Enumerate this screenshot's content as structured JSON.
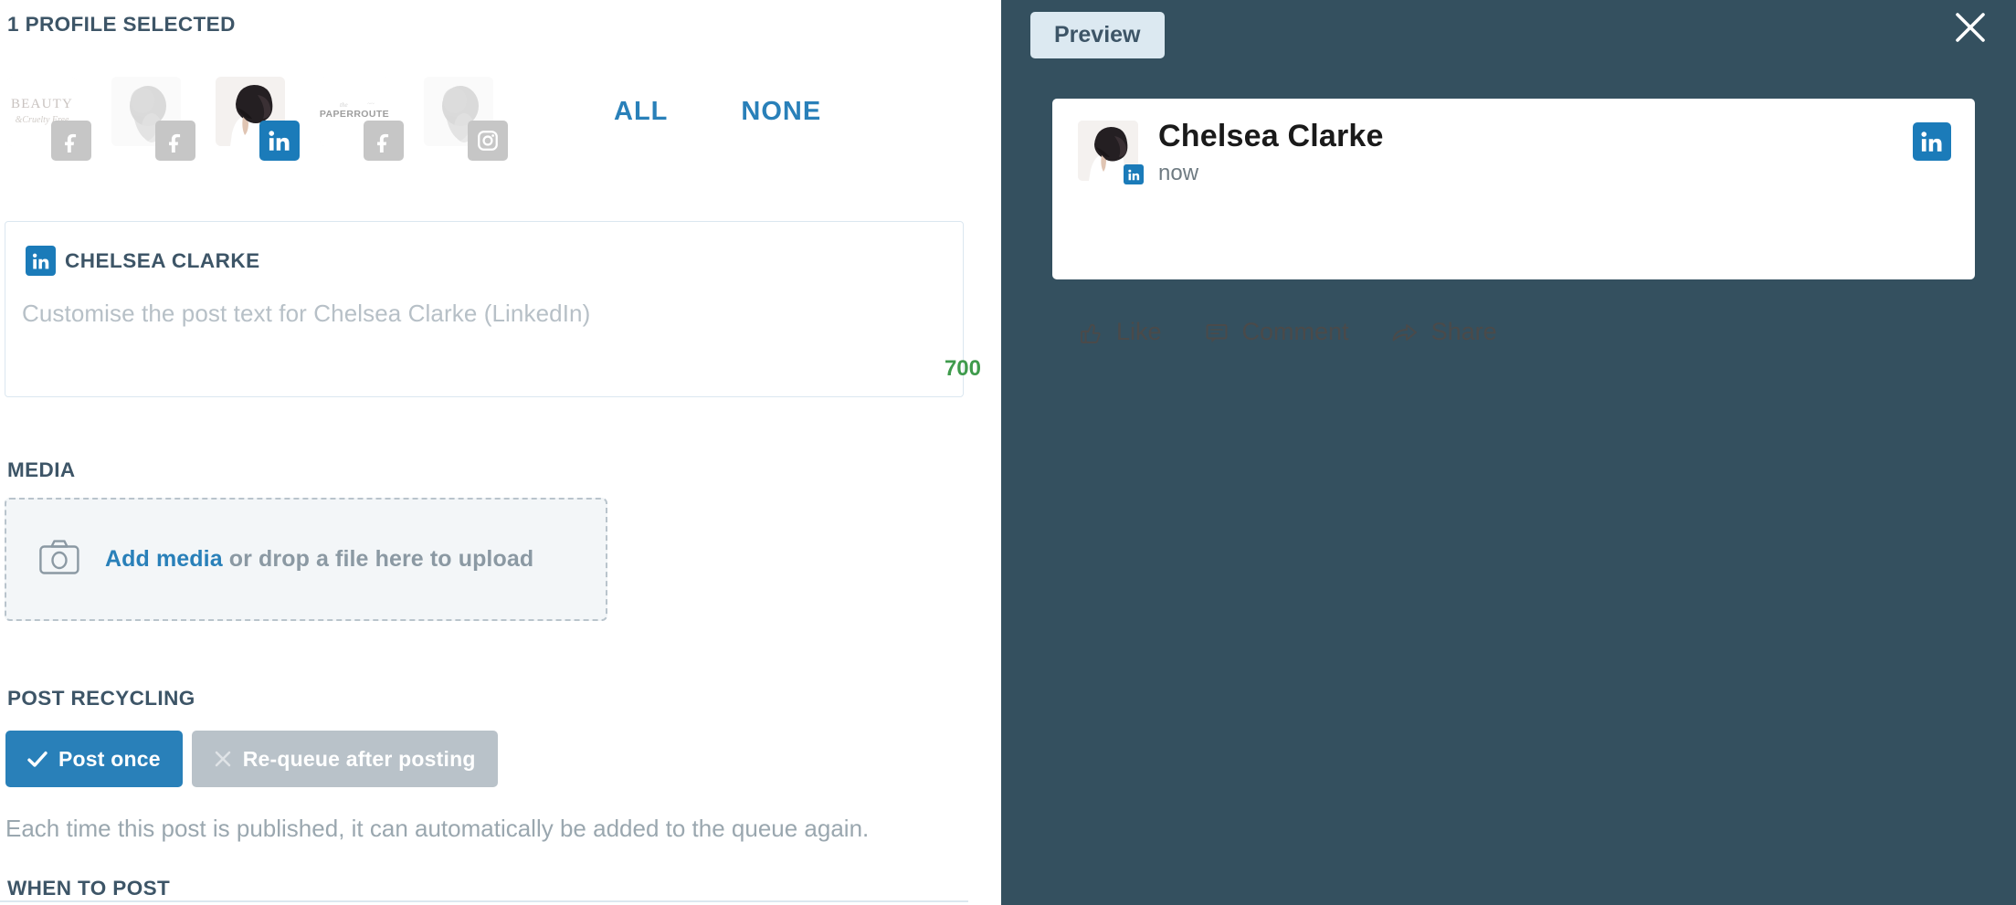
{
  "composer": {
    "profiles_heading": "1 PROFILE SELECTED",
    "profiles": [
      {
        "name": "beauty-cruelty-free",
        "network": "facebook",
        "selected": false,
        "icon": "facebook-icon"
      },
      {
        "name": "hair-profile-2",
        "network": "facebook",
        "selected": false,
        "icon": "facebook-icon"
      },
      {
        "name": "chelsea-clarke",
        "network": "linkedin",
        "selected": true,
        "icon": "linkedin-icon"
      },
      {
        "name": "the-paperroute",
        "network": "facebook",
        "selected": false,
        "icon": "facebook-icon"
      },
      {
        "name": "hair-profile-5",
        "network": "instagram",
        "selected": false,
        "icon": "instagram-icon"
      }
    ],
    "select_all_label": "ALL",
    "select_none_label": "NONE",
    "network_editor": {
      "network_icon": "linkedin-icon",
      "profile_name": "CHELSEA CLARKE",
      "placeholder": "Customise the post text for Chelsea Clarke (LinkedIn)",
      "value": "",
      "char_count": "700",
      "char_count_color": "#3f9b4c"
    },
    "media": {
      "heading": "MEDIA",
      "camera_icon": "camera-icon",
      "link_label": "Add media",
      "rest_label": " or drop a file here to upload"
    },
    "post_recycling": {
      "heading": "POST RECYCLING",
      "options": [
        {
          "label": "Post once",
          "glyph": "check-icon",
          "active": true
        },
        {
          "label": "Re-queue after posting",
          "glyph": "close-icon",
          "active": false
        }
      ],
      "help_text": "Each time this post is published, it can automatically be added to the queue again."
    },
    "when_to_post": {
      "heading": "WHEN TO POST"
    },
    "scrollbar": {
      "name": "composer-scrollbar"
    }
  },
  "preview": {
    "tab_label": "Preview",
    "close_icon": "close-icon",
    "card": {
      "author": "Chelsea Clarke",
      "timestamp": "now",
      "network_icon": "linkedin-icon",
      "avatar_badge_icon": "linkedin-icon",
      "actions": [
        {
          "label": "Like",
          "icon": "thumbs-up-icon"
        },
        {
          "label": "Comment",
          "icon": "comment-icon"
        },
        {
          "label": "Share",
          "icon": "share-arrow-icon"
        }
      ]
    }
  },
  "colors": {
    "panel_dark": "#34505f",
    "accent_blue": "#2980b9",
    "linkedin_blue": "#1b7bb9",
    "muted_gray": "#b9c2c9",
    "heading": "#3d5567",
    "green": "#3f9b4c"
  }
}
